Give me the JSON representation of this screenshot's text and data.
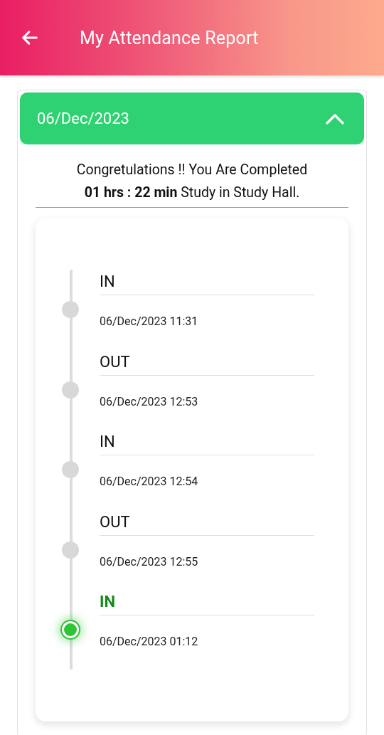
{
  "header": {
    "title": "My Attendance Report"
  },
  "day": {
    "date": "06/Dec/2023",
    "expanded": true,
    "summary": [
      "Congretulations !! You Are Completed",
      "**01 hrs : 22 min** Study in Study Hall."
    ],
    "entries": [
      {
        "label": "IN",
        "time": "06/Dec/2023 11:31",
        "active": false
      },
      {
        "label": "OUT",
        "time": "06/Dec/2023 12:53",
        "active": false
      },
      {
        "label": "IN",
        "time": "06/Dec/2023 12:54",
        "active": false
      },
      {
        "label": "OUT",
        "time": "06/Dec/2023 12:55",
        "active": false
      },
      {
        "label": "IN",
        "time": "06/Dec/2023 01:12",
        "active": true
      }
    ]
  }
}
